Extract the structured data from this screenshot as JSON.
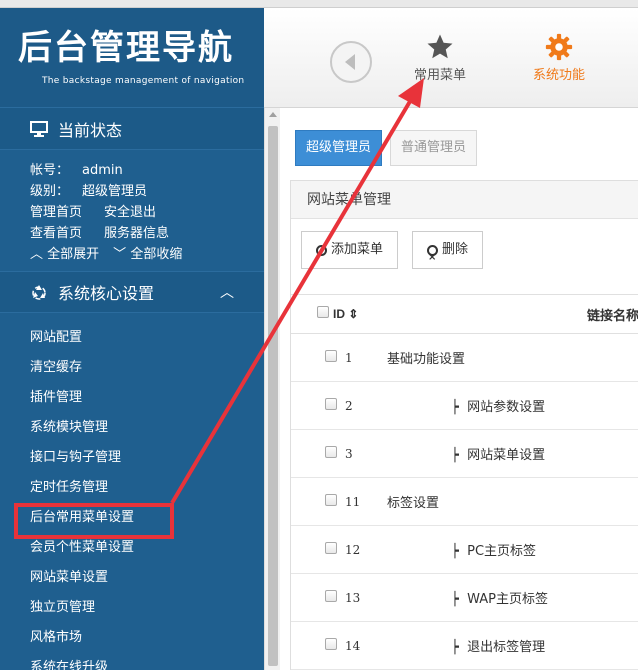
{
  "brand": {
    "title": "后台管理导航",
    "subtitle": "The backstage management of navigation"
  },
  "topnav": {
    "back_icon": "back-arrow-icon",
    "common_menu": {
      "label": "常用菜单",
      "icon": "star-icon"
    },
    "system_function": {
      "label": "系统功能",
      "icon": "gear-icon",
      "color": "#f07a1a"
    }
  },
  "sidebar": {
    "status_section": {
      "title": "当前状态",
      "icon": "monitor-icon"
    },
    "account": {
      "label": "帐号：",
      "value": "admin"
    },
    "level": {
      "label": "级别：",
      "value": "超级管理员"
    },
    "links_row1": [
      "管理首页",
      "安全退出"
    ],
    "links_row2": [
      "查看首页",
      "服务器信息"
    ],
    "expand_all": "全部展开",
    "collapse_all": "全部收缩",
    "core_section": {
      "title": "系统核心设置",
      "icon": "recycle-icon",
      "chevron": "^"
    },
    "menu_items": [
      "网站配置",
      "清空缓存",
      "插件管理",
      "系统模块管理",
      "接口与钩子管理",
      "定时任务管理",
      "后台常用菜单设置",
      "会员个性菜单设置",
      "网站菜单设置",
      "独立页管理",
      "风格市场",
      "系统在线升级"
    ],
    "highlighted_item_index": 6
  },
  "main": {
    "tabs": [
      "超级管理员",
      "普通管理员"
    ],
    "active_tab": 0,
    "panel_title": "网站菜单管理",
    "toolbar": {
      "add_label": "添加菜单",
      "delete_label": "删除"
    },
    "table": {
      "headers": {
        "id": "ID",
        "link_name": "链接名称"
      },
      "rows": [
        {
          "id": "1",
          "name": "基础功能设置",
          "child": false
        },
        {
          "id": "2",
          "name": "网站参数设置",
          "child": true
        },
        {
          "id": "3",
          "name": "网站菜单设置",
          "child": true
        },
        {
          "id": "11",
          "name": "标签设置",
          "child": false
        },
        {
          "id": "12",
          "name": "PC主页标签",
          "child": true
        },
        {
          "id": "13",
          "name": "WAP主页标签",
          "child": true
        },
        {
          "id": "14",
          "name": "退出标签管理",
          "child": true
        }
      ]
    }
  },
  "colors": {
    "sidebar_bg": "#1f5f8f",
    "accent_blue": "#3d8ed6",
    "annotation_red": "#e8333a"
  }
}
